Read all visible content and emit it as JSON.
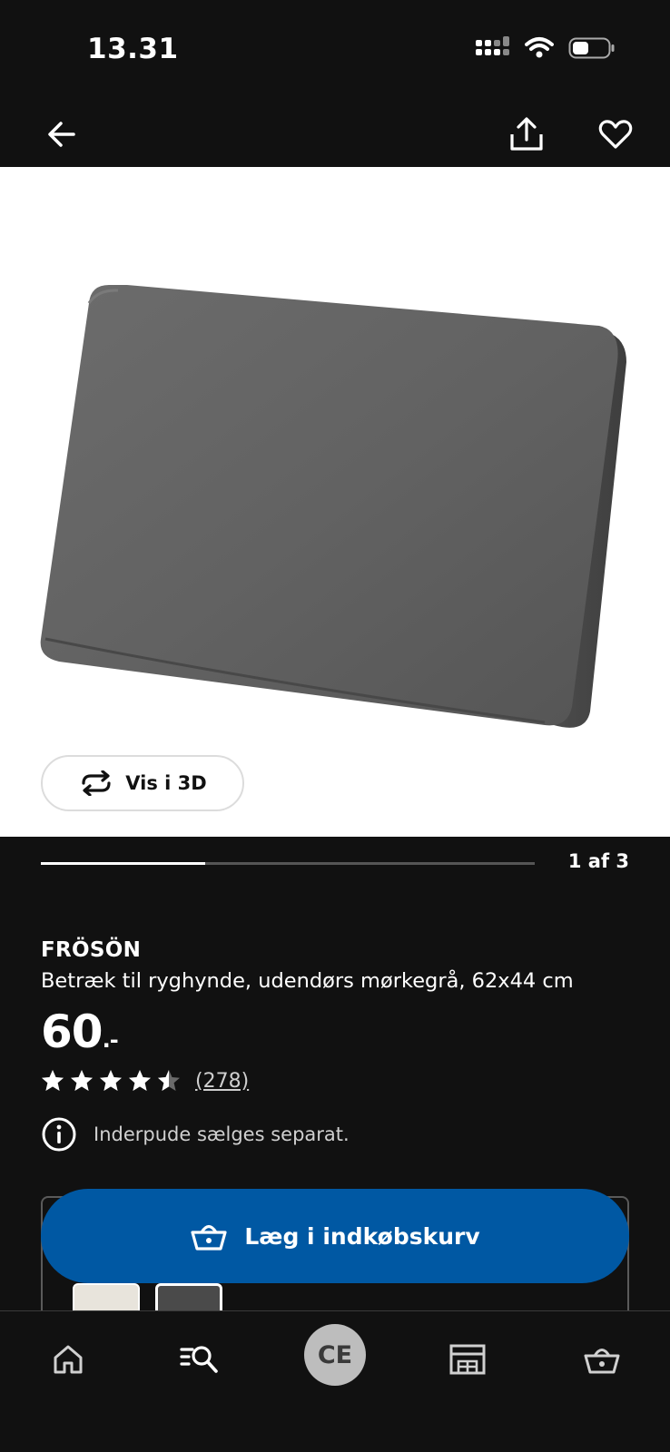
{
  "status_bar": {
    "time": "13.31",
    "signal_icon": "signal-icon",
    "wifi_icon": "wifi-icon",
    "battery_icon": "battery-icon"
  },
  "top_nav": {
    "back_icon": "arrow-left-icon",
    "share_icon": "share-icon",
    "favorite_icon": "heart-icon"
  },
  "product_image": {
    "view_3d_label": "Vis i 3D",
    "view_3d_icon": "rotate-icon"
  },
  "gallery": {
    "current": 1,
    "total": 3,
    "label": "1 af 3",
    "progress_fraction": 0.333
  },
  "product": {
    "brand": "FRÖSÖN",
    "description": "Betræk til ryghynde, udendørs mørkegrå, 62x44 cm",
    "price_integer": "60",
    "price_suffix": ".-",
    "rating_value": 4.5,
    "rating_max": 5,
    "review_count": "(278)",
    "info_icon": "info-icon",
    "info_text": "Inderpude sælges separat."
  },
  "variants": [
    {
      "name": "beige-variant",
      "color": "#e8e4dc"
    },
    {
      "name": "dark-grey-variant",
      "color": "#4a4a4a",
      "selected": true
    }
  ],
  "add_to_cart": {
    "label": "Læg i indkøbskurv",
    "icon": "basket-icon",
    "color": "#0058a3"
  },
  "bottom_nav": {
    "home_icon": "home-icon",
    "search_icon": "search-list-icon",
    "avatar_initials": "CE",
    "store_icon": "store-icon",
    "cart_icon": "basket-icon"
  },
  "colors": {
    "background": "#111111",
    "accent": "#0058a3",
    "image_bg": "#ffffff"
  }
}
